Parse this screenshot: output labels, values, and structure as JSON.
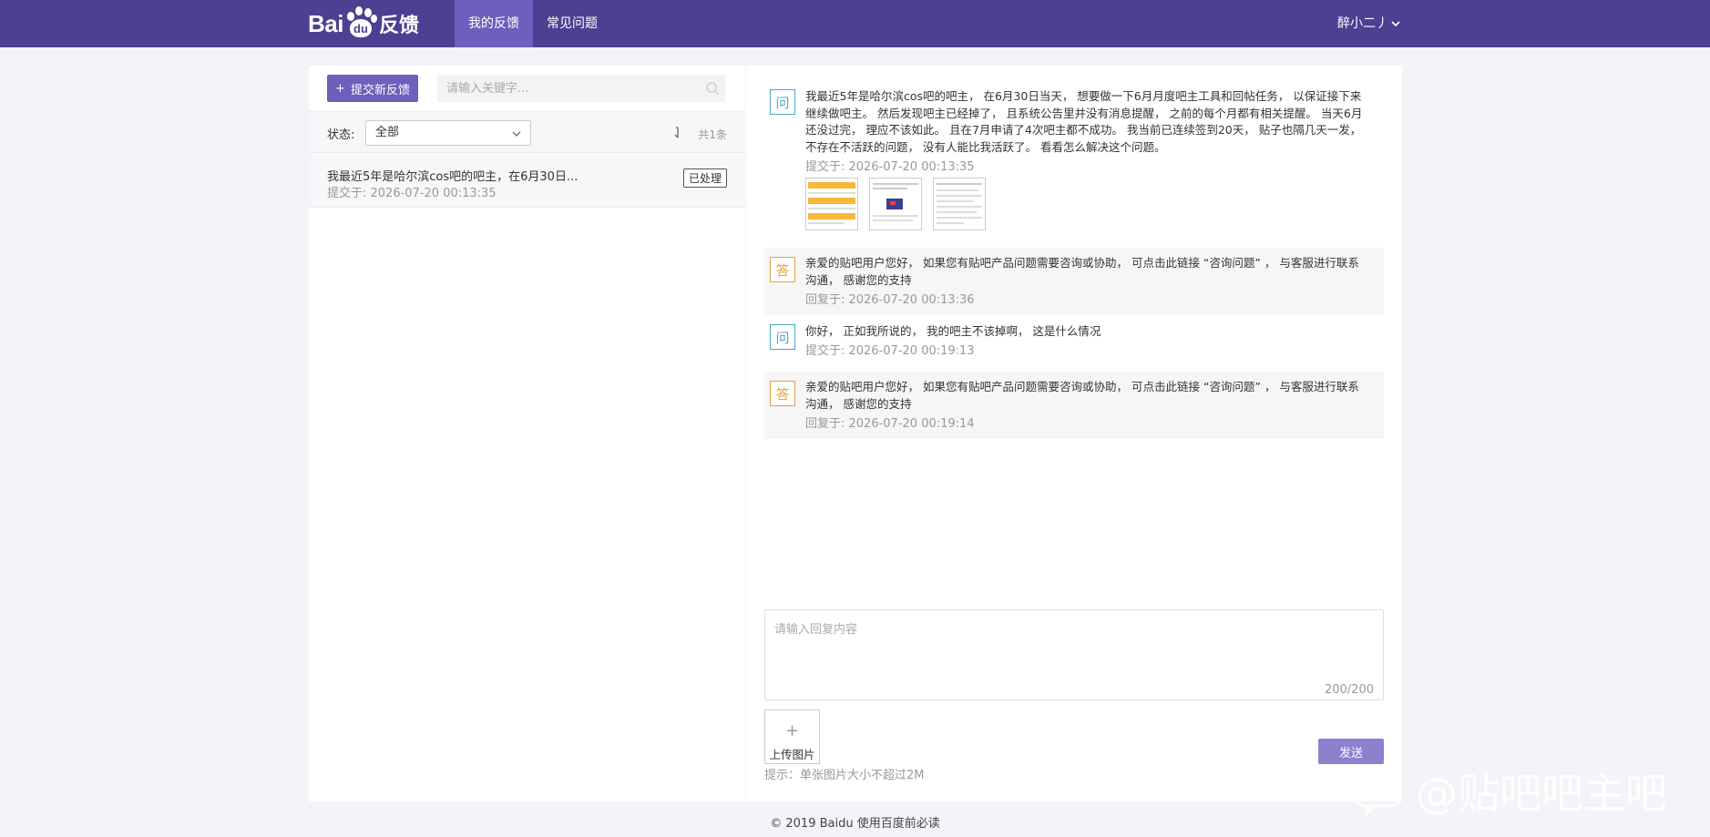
{
  "header": {
    "logo_text": "Bai",
    "logo_du": "du",
    "logo_suffix": "反馈",
    "tabs": [
      {
        "label": "我的反馈",
        "active": true
      },
      {
        "label": "常见问题",
        "active": false
      }
    ],
    "username": "醉小二丿"
  },
  "sidebar": {
    "submit_label": "提交新反馈",
    "search_placeholder": "请输入关键字...",
    "filter_label": "状态:",
    "status_selected": "全部",
    "count_text": "共1条",
    "items": [
      {
        "title": "我最近5年是哈尔滨cos吧的吧主，在6月30日...",
        "time": "提交于:  2026-07-20 00:13:35",
        "status": "已处理"
      }
    ]
  },
  "conversation": {
    "messages": [
      {
        "type": "question",
        "tag": "问",
        "text": "我最近5年是哈尔滨cos吧的吧主， 在6月30日当天， 想要做一下6月月度吧主工具和回帖任务， 以保证接下来继续做吧主。 然后发现吧主已经掉了， 且系统公告里并没有消息提醒， 之前的每个月都有相关提醒。 当天6月还没过完， 理应不该如此。 且在7月申请了4次吧主都不成功。 我当前已连续签到20天， 贴子也隔几天一发， 不存在不活跃的问题， 没有人能比我活跃了。 看看怎么解决这个问题。",
        "meta": "提交于:  2026-07-20 00:13:35",
        "images": [
          "screenshot-1",
          "screenshot-2",
          "screenshot-3"
        ]
      },
      {
        "type": "answer",
        "tag": "答",
        "text": "亲爱的贴吧用户您好， 如果您有贴吧产品问题需要咨询或协助， 可点击此链接 “咨询问题” ， 与客服进行联系沟通， 感谢您的支持",
        "meta": "回复于:  2026-07-20 00:13:36"
      },
      {
        "type": "question",
        "tag": "问",
        "text": "你好， 正如我所说的， 我的吧主不该掉啊， 这是什么情况",
        "meta": "提交于:  2026-07-20 00:19:13"
      },
      {
        "type": "answer",
        "tag": "答",
        "text": "亲爱的贴吧用户您好， 如果您有贴吧产品问题需要咨询或协助， 可点击此链接 “咨询问题” ， 与客服进行联系沟通， 感谢您的支持",
        "meta": "回复于:  2026-07-20 00:19:14"
      }
    ],
    "reply_placeholder": "请输入回复内容",
    "char_counter": "200/200",
    "upload_label": "上传图片",
    "upload_plus": "+",
    "hint": "提示：单张图片大小不超过2M",
    "send_label": "发送"
  },
  "footer": {
    "text": "© 2019 Baidu 使用百度前必读"
  },
  "watermark": {
    "text": "@贴吧吧主吧"
  },
  "colors": {
    "header_bg": "#4d3f91",
    "active_tab": "#6e5fbd",
    "primary_button": "#6e5fbd",
    "send_button": "#8d81cf",
    "question_tag": "#4aa6c4",
    "answer_tag": "#e0a63d",
    "page_bg": "#f3f3f8"
  }
}
